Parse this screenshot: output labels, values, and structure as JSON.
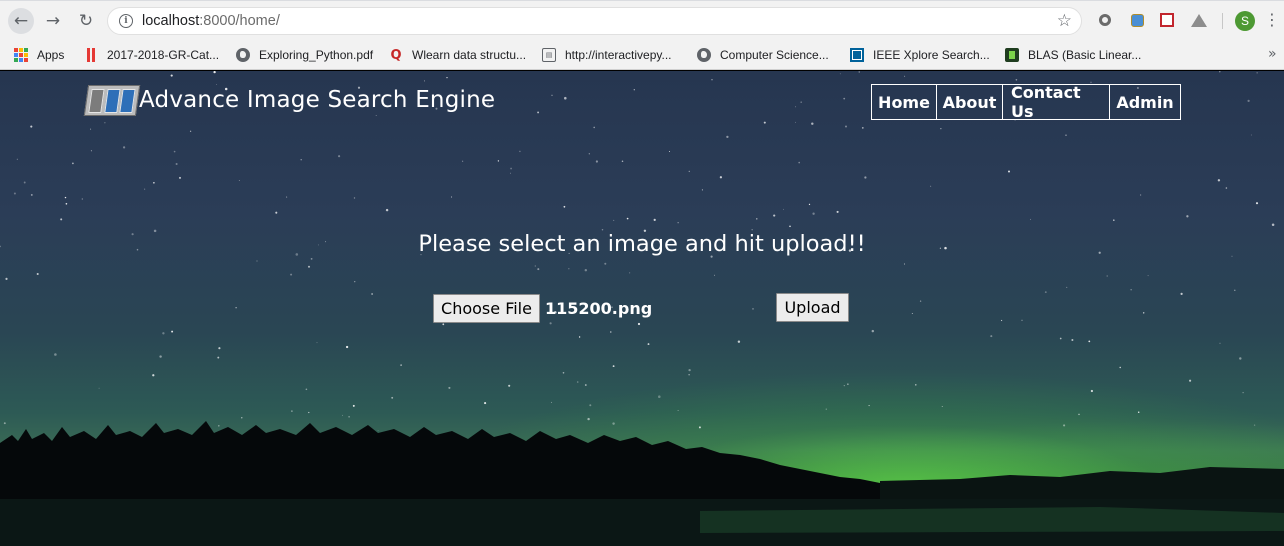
{
  "browser": {
    "url_host": "localhost",
    "url_path": ":8000/home/",
    "profile_initial": "S"
  },
  "bookmarks": [
    {
      "label": "Apps",
      "icon": "apps-grid-icon"
    },
    {
      "label": "2017-2018-GR-Cat...",
      "icon": "red-bars-icon"
    },
    {
      "label": "Exploring_Python.pdf",
      "icon": "globe-icon"
    },
    {
      "label": "Wlearn data structu...",
      "icon": "quizlet-q-icon"
    },
    {
      "label": "http://interactivepy...",
      "icon": "page-icon"
    },
    {
      "label": "Computer Science...",
      "icon": "globe-icon"
    },
    {
      "label": "IEEE Xplore Search...",
      "icon": "ieee-icon"
    },
    {
      "label": "BLAS (Basic Linear...",
      "icon": "blas-icon"
    }
  ],
  "site": {
    "title": "Advance Image Search Engine",
    "nav": [
      {
        "label": "Home"
      },
      {
        "label": "About"
      },
      {
        "label": "Contact Us"
      },
      {
        "label": "Admin"
      }
    ]
  },
  "upload": {
    "prompt": "Please select an image and hit upload!!",
    "choose_label": "Choose File",
    "file_name": "115200.png",
    "upload_label": "Upload"
  },
  "colors": {
    "chrome_bg": "#f2f2f2",
    "sky_top": "#263650",
    "aurora": "#64e646",
    "text": "#ffffff"
  }
}
